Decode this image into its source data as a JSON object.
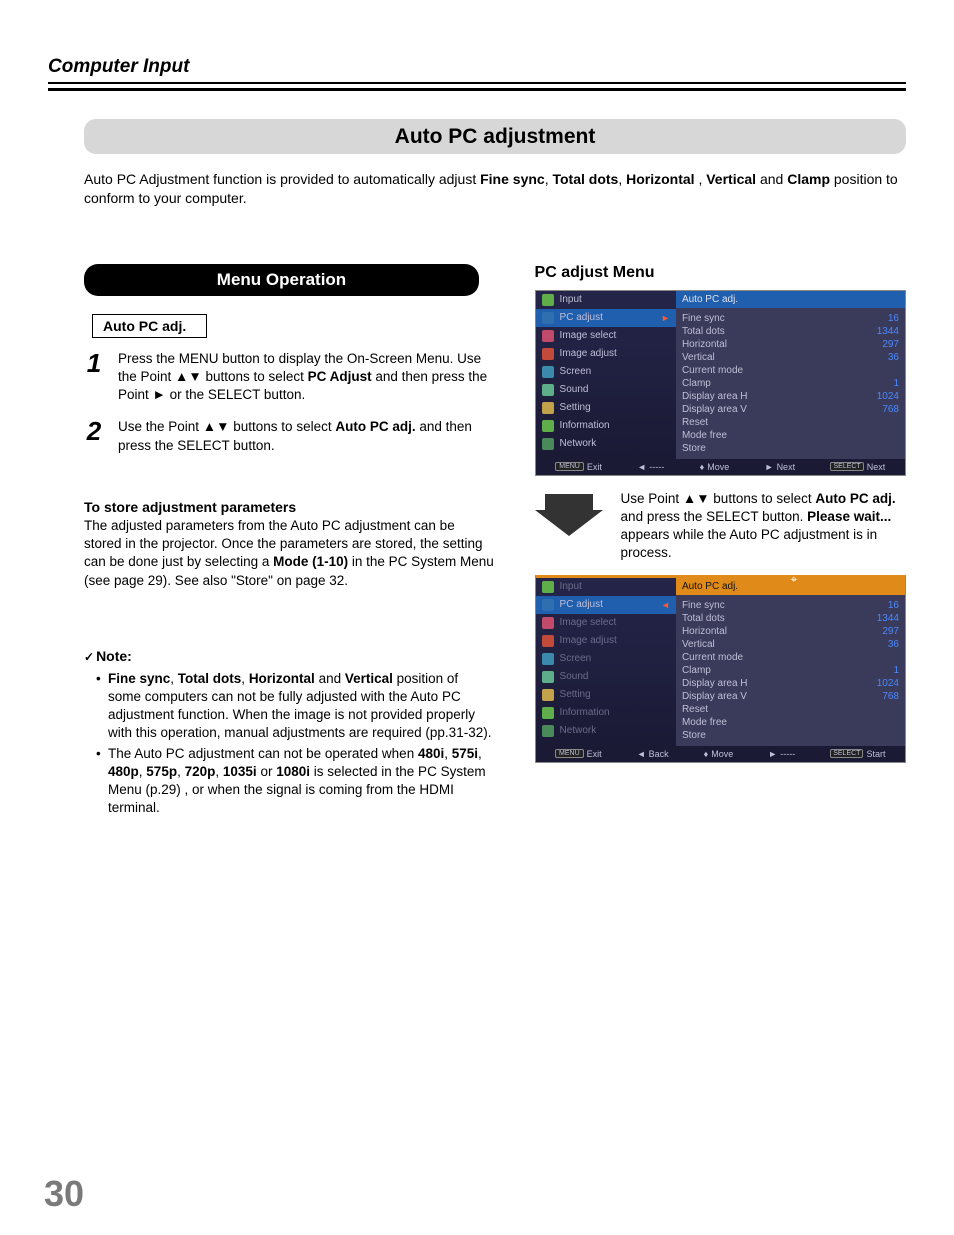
{
  "header": "Computer Input",
  "title": "Auto PC adjustment",
  "intro": {
    "pre": "Auto PC Adjustment function is provided to automatically adjust ",
    "b1": "Fine sync",
    "s1": ", ",
    "b2": "Total dots",
    "s2": ", ",
    "b3": "Horizontal",
    "s3": " , ",
    "b4": "Vertical",
    "s4": " and ",
    "b5": "Clamp",
    "post": " position to conform to your computer."
  },
  "menuOp": "Menu Operation",
  "subBox": "Auto PC adj.",
  "steps": [
    {
      "n": "1",
      "pre": "Press the MENU button to display the On-Screen Menu. Use the Point ▲▼ buttons to select ",
      "b": "PC Adjust",
      "post": " and then press the Point ► or the SELECT button."
    },
    {
      "n": "2",
      "pre": "Use the Point ▲▼ buttons to select ",
      "b": "Auto PC adj.",
      "post": " and then press the SELECT button."
    }
  ],
  "storeHead": "To store adjustment parameters",
  "storeBody": {
    "pre": "The adjusted parameters from the Auto PC adjustment can be stored in the projector. Once the parameters are stored, the setting can be done just by selecting a ",
    "b": "Mode (1-10)",
    "post": " in the PC System Menu (see page 29). See also \"Store\" on page 32."
  },
  "noteHead": "Note:",
  "notes": [
    {
      "parts": [
        {
          "t": "b",
          "v": "Fine sync"
        },
        {
          "t": "n",
          "v": ", "
        },
        {
          "t": "b",
          "v": "Total dots"
        },
        {
          "t": "n",
          "v": ", "
        },
        {
          "t": "b",
          "v": "Horizontal"
        },
        {
          "t": "n",
          "v": " and "
        },
        {
          "t": "b",
          "v": "Vertical"
        },
        {
          "t": "n",
          "v": " position of some computers can not be fully adjusted with the Auto PC adjustment function. When the image is not provided properly with this operation, manual adjustments are required (pp.31-32)."
        }
      ]
    },
    {
      "parts": [
        {
          "t": "n",
          "v": "The Auto PC adjustment can not be operated when "
        },
        {
          "t": "b",
          "v": "480i"
        },
        {
          "t": "n",
          "v": ", "
        },
        {
          "t": "b",
          "v": "575i"
        },
        {
          "t": "n",
          "v": ", "
        },
        {
          "t": "b",
          "v": "480p"
        },
        {
          "t": "n",
          "v": ", "
        },
        {
          "t": "b",
          "v": "575p"
        },
        {
          "t": "n",
          "v": ", "
        },
        {
          "t": "b",
          "v": "720p"
        },
        {
          "t": "n",
          "v": ", "
        },
        {
          "t": "b",
          "v": "1035i"
        },
        {
          "t": "n",
          "v": " or "
        },
        {
          "t": "b",
          "v": "1080i"
        },
        {
          "t": "n",
          "v": " is selected in the PC System Menu (p.29) , or when the signal is coming from the HDMI terminal."
        }
      ]
    }
  ],
  "rightTitle": "PC adjust Menu",
  "sideItems": [
    "Input",
    "PC adjust",
    "Image select",
    "Image adjust",
    "Screen",
    "Sound",
    "Setting",
    "Information",
    "Network"
  ],
  "menu1": {
    "header": "Auto PC adj.",
    "rows": [
      {
        "k": "Fine sync",
        "v": "16"
      },
      {
        "k": "Total dots",
        "v": "1344"
      },
      {
        "k": "Horizontal",
        "v": "297"
      },
      {
        "k": "Vertical",
        "v": "36"
      },
      {
        "k": "Current mode",
        "v": ""
      },
      {
        "k": "Clamp",
        "v": "1"
      },
      {
        "k": "Display area H",
        "v": "1024"
      },
      {
        "k": "Display area V",
        "v": "768"
      },
      {
        "k": "Reset",
        "v": ""
      },
      {
        "k": "Mode free",
        "v": ""
      },
      {
        "k": "Store",
        "v": ""
      }
    ],
    "footer": {
      "f1": "Exit",
      "f2": "-----",
      "f3": "Move",
      "f4": "Next",
      "f5": "Next"
    }
  },
  "arrowText": {
    "pre": "Use Point ▲▼ buttons to select ",
    "b1": "Auto PC adj.",
    "mid": " and press the SELECT button. ",
    "b2": "Please wait...",
    "post": " appears while the Auto PC adjustment is in process."
  },
  "menu2": {
    "header": "Auto PC adj.",
    "rows": [
      {
        "k": "Fine sync",
        "v": "16"
      },
      {
        "k": "Total dots",
        "v": "1344"
      },
      {
        "k": "Horizontal",
        "v": "297"
      },
      {
        "k": "Vertical",
        "v": "36"
      },
      {
        "k": "Current mode",
        "v": ""
      },
      {
        "k": "Clamp",
        "v": "1"
      },
      {
        "k": "Display area H",
        "v": "1024"
      },
      {
        "k": "Display area V",
        "v": "768"
      },
      {
        "k": "Reset",
        "v": ""
      },
      {
        "k": "Mode free",
        "v": ""
      },
      {
        "k": "Store",
        "v": ""
      }
    ],
    "footer": {
      "f1": "Exit",
      "f2": "Back",
      "f3": "Move",
      "f4": "-----",
      "f5": "Start"
    }
  },
  "pageNum": "30"
}
